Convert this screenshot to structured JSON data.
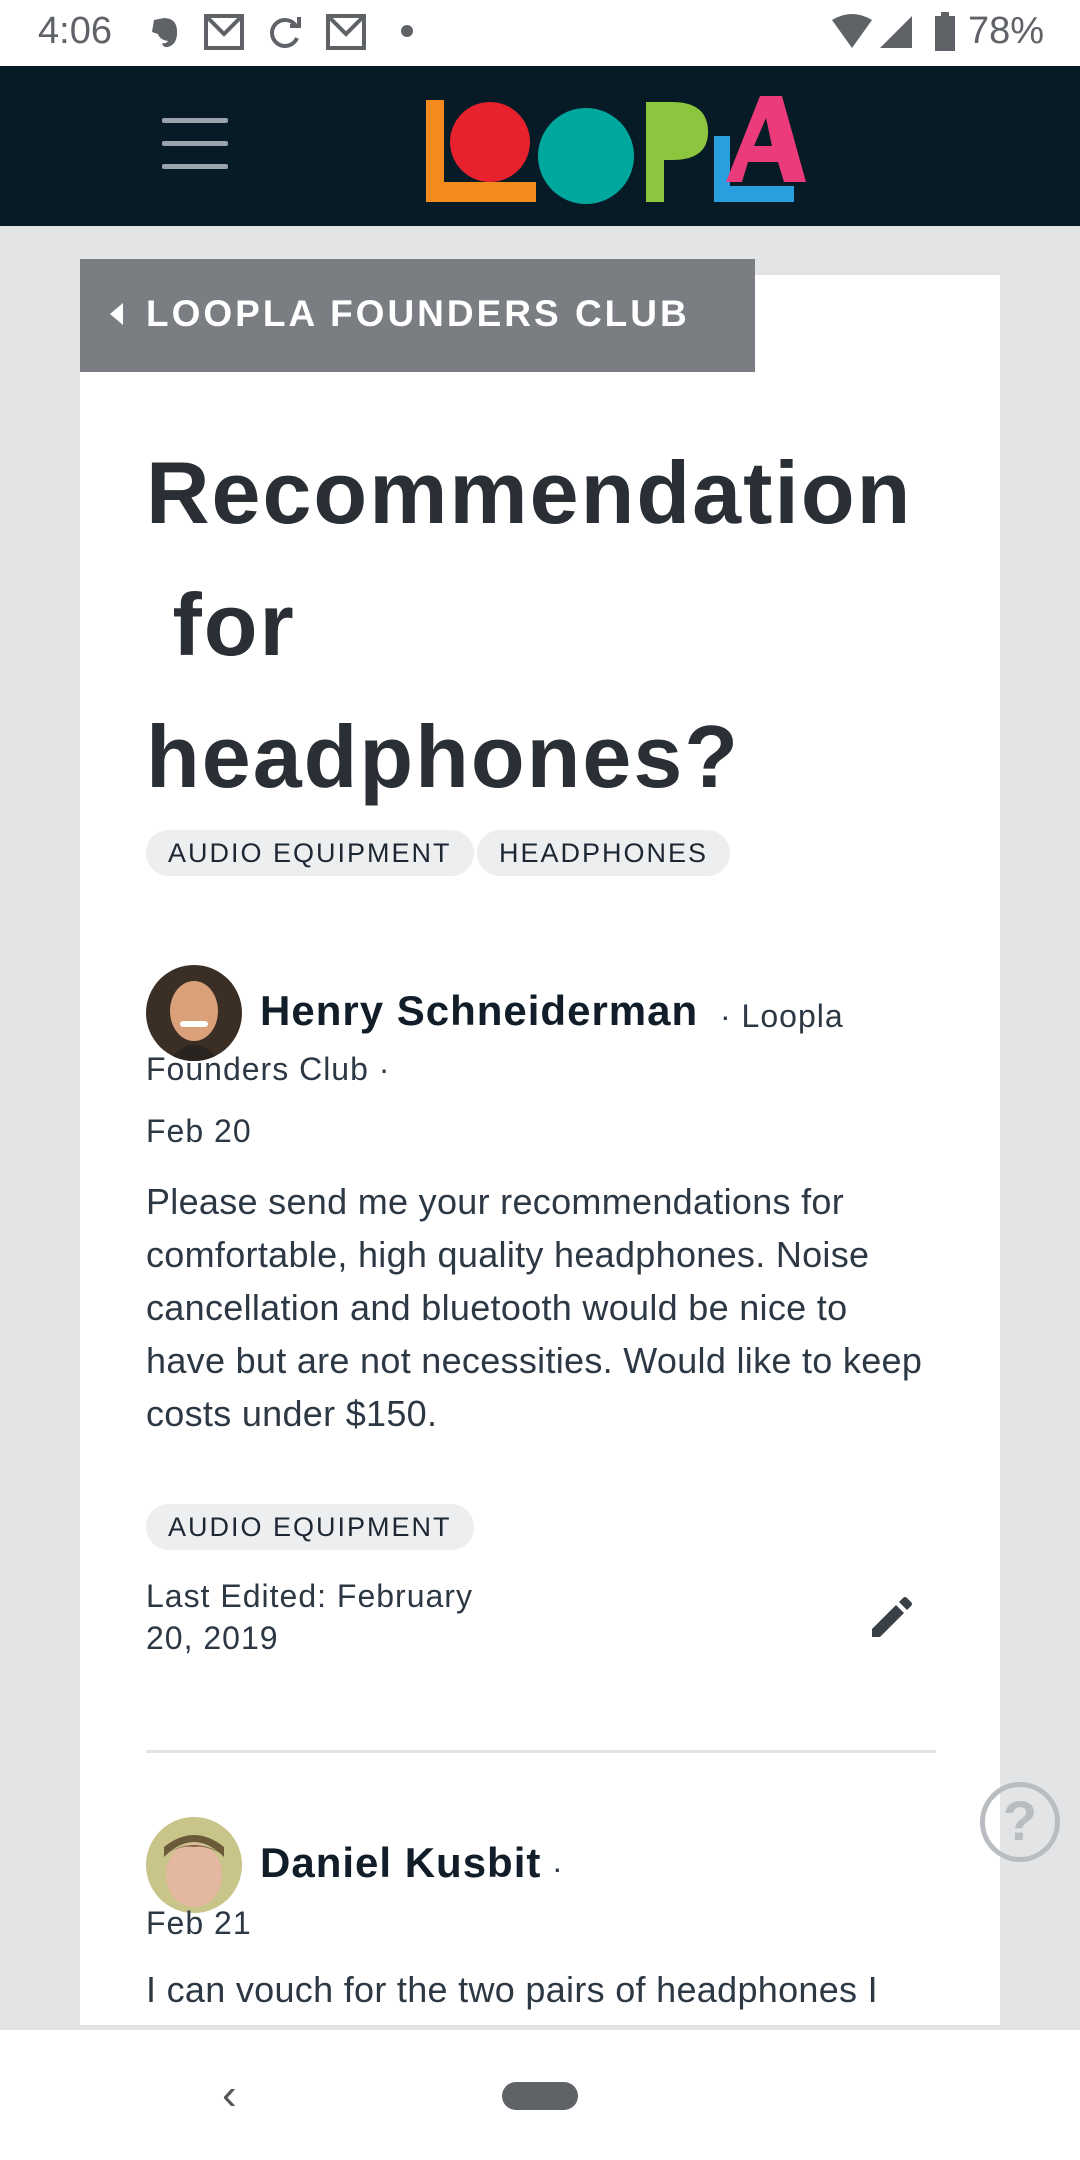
{
  "status_bar": {
    "time": "4:06",
    "battery": "78%",
    "icons": [
      "evernote-icon",
      "gmail-icon",
      "sync-icon",
      "gmail-icon",
      "dot-icon",
      "wifi-icon",
      "signal-icon",
      "battery-icon"
    ]
  },
  "header": {
    "logo_text": "LOOPLA",
    "logo_colors": [
      "#f28a1e",
      "#e8212e",
      "#00a79d",
      "#8cc63f",
      "#ec3b7a",
      "#2a9fe0"
    ]
  },
  "breadcrumb": {
    "label": "LOOPLA FOUNDERS CLUB"
  },
  "post": {
    "title_line1": "Recommendation",
    "title_line2": " for",
    "title_line3": "headphones?",
    "tags": [
      "AUDIO EQUIPMENT",
      "HEADPHONES"
    ],
    "author": "Henry Schneiderman",
    "group_line1": "· Loopla",
    "group_line2": "Founders Club ·",
    "date": "Feb 20",
    "body": "Please send me your recommendations for comfortable, high quality headphones. Noise cancellation and bluetooth would be nice to have but are not necessities. Would like to keep costs under $150.",
    "category": "AUDIO EQUIPMENT",
    "last_edited_line1": "Last Edited: February",
    "last_edited_line2": "20, 2019"
  },
  "reply": {
    "author": "Daniel Kusbit",
    "separator": "·",
    "date": "Feb 21",
    "body": "I can vouch for the two pairs of headphones I"
  },
  "help": {
    "label": "?"
  },
  "nav": {
    "back": "‹"
  }
}
